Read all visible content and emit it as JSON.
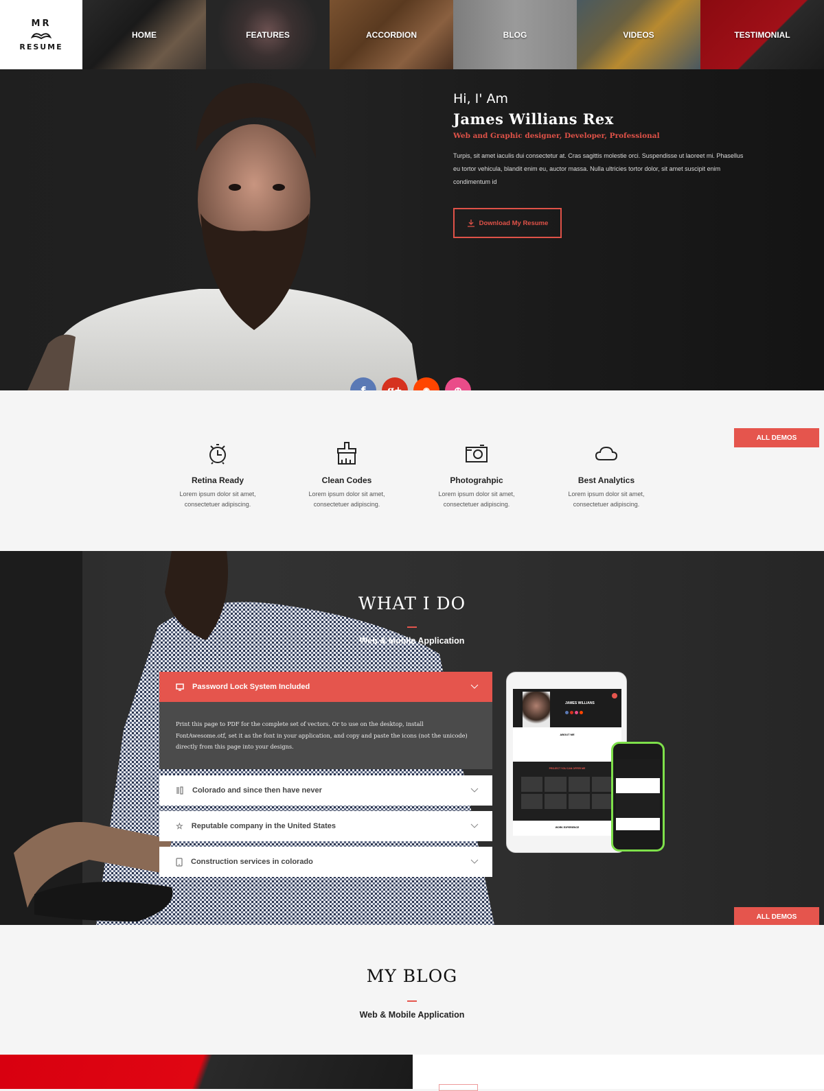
{
  "brand": {
    "line1": "MR",
    "line2": "RESUME"
  },
  "nav": {
    "items": [
      {
        "label": "HOME"
      },
      {
        "label": "FEATURES"
      },
      {
        "label": "ACCORDION"
      },
      {
        "label": "BLOG"
      },
      {
        "label": "VIDEOS"
      },
      {
        "label": "TESTIMONIAL"
      }
    ]
  },
  "hero": {
    "greeting": "Hi, I' Am",
    "name": "James Willians Rex",
    "role": "Web and Graphic designer, Developer, Professional",
    "bio": "Turpis, sit amet iaculis dui consectetur at. Cras sagittis molestie orci. Suspendisse ut laoreet mi. Phasellus eu tortor vehicula, blandit enim eu, auctor massa. Nulla ultricies tortor dolor, sit amet suscipit enim condimentum id",
    "download_label": "Download My Resume"
  },
  "social": [
    {
      "name": "facebook",
      "glyph": "f",
      "color": "#5a79b5"
    },
    {
      "name": "google-plus",
      "glyph": "g+",
      "color": "#d6321f"
    },
    {
      "name": "reddit",
      "glyph": "◉",
      "color": "#ff4500"
    },
    {
      "name": "dribbble",
      "glyph": "⊕",
      "color": "#ea4c89"
    }
  ],
  "features": [
    {
      "icon": "alarm-clock-icon",
      "title": "Retina Ready",
      "desc1": "Lorem ipsum dolor sit amet,",
      "desc2": "consectetuer adipiscing."
    },
    {
      "icon": "paint-brush-icon",
      "title": "Clean Codes",
      "desc1": "Lorem ipsum dolor sit amet,",
      "desc2": "consectetuer adipiscing."
    },
    {
      "icon": "camera-icon",
      "title": "Photograhpic",
      "desc1": "Lorem ipsum dolor sit amet,",
      "desc2": "consectetuer adipiscing."
    },
    {
      "icon": "cloud-icon",
      "title": "Best Analytics",
      "desc1": "Lorem ipsum dolor sit amet,",
      "desc2": "consectetuer adipiscing."
    }
  ],
  "all_demos_label": "ALL DEMOS",
  "what_i_do": {
    "title": "WHAT I DO",
    "subtitle": "Web & Mobile Application",
    "accordion": [
      {
        "icon": "monitor-icon",
        "title": "Password Lock System Included",
        "open": true,
        "body": "Print this page to PDF for the complete set of vectors. Or to use on the desktop, install FontAwesome.otf, set it as the font in your application, and copy and paste the icons (not the unicode) directly from this page into your designs."
      },
      {
        "icon": "tools-icon",
        "title": "Colorado and since then have never",
        "open": false
      },
      {
        "icon": "star-icon",
        "title": "Reputable company in the United States",
        "open": false
      },
      {
        "icon": "mobile-icon",
        "title": "Construction services in colorado",
        "open": false
      }
    ],
    "mockup": {
      "name": "JAMES WILLIANS",
      "about": "ABOUT ME",
      "projects": "PROJECT YOU CAN OFFER ME",
      "work": "WORK EXPERIENCE"
    }
  },
  "blog": {
    "title": "MY BLOG",
    "subtitle": "Web & Mobile Application"
  },
  "colors": {
    "accent": "#e5554d",
    "dark": "#1f1f1f",
    "light": "#f5f5f5"
  }
}
